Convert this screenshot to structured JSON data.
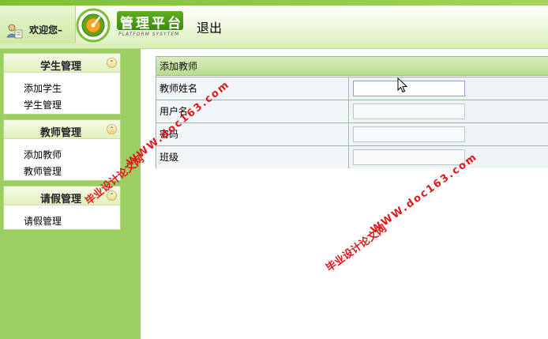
{
  "header": {
    "welcome": "欢迎您–",
    "brand_title": "管理平台",
    "brand_sub": "PLATFORM SYSYTEM",
    "logout": "退出"
  },
  "sidebar": {
    "panels": [
      {
        "title": "学生管理",
        "items": [
          "添加学生",
          "学生管理"
        ]
      },
      {
        "title": "教师管理",
        "items": [
          "添加教师",
          "教师管理"
        ]
      },
      {
        "title": "请假管理",
        "items": [
          "请假管理"
        ]
      }
    ],
    "collapse_glyph": "«"
  },
  "form": {
    "title": "添加教师",
    "fields": [
      {
        "label": "教师姓名",
        "value": ""
      },
      {
        "label": "用户名",
        "value": ""
      },
      {
        "label": "密码",
        "value": ""
      },
      {
        "label": "班级",
        "value": ""
      }
    ]
  },
  "watermarks": [
    {
      "line1": "毕业设计论文网",
      "line2": "WWW.doc163.com"
    },
    {
      "line1": "毕业设计论文网",
      "line2": "WWW.doc163.com"
    }
  ],
  "colors": {
    "sidebar_bg": "#9ccf62",
    "accent_green": "#4a9a18",
    "watermark": "#e01818"
  }
}
